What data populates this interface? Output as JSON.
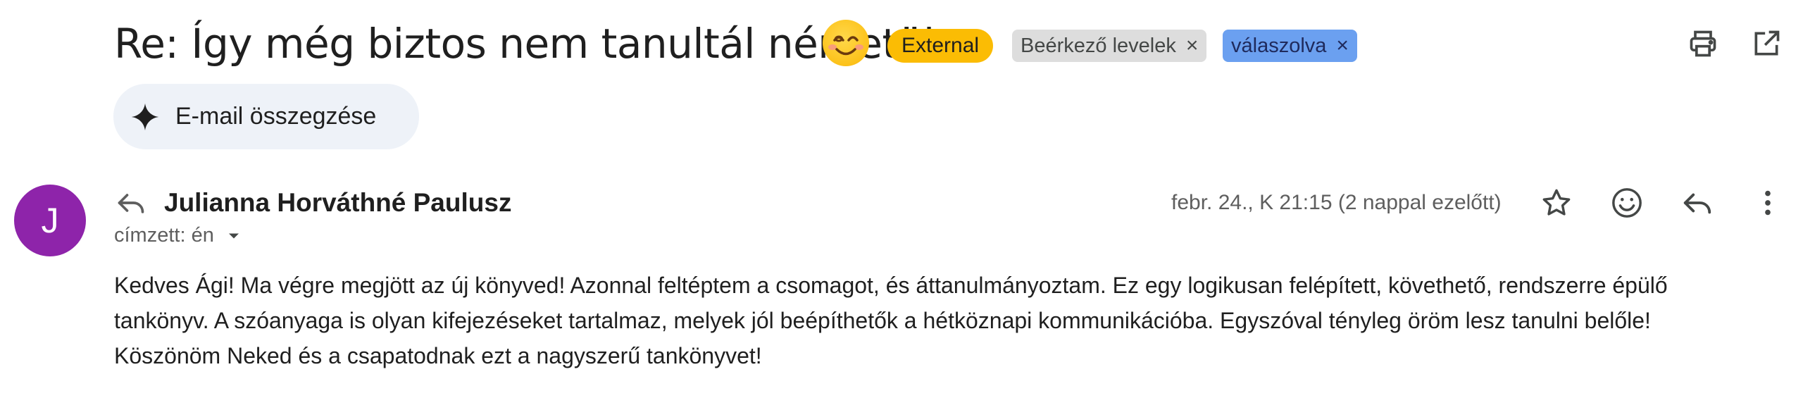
{
  "subject": {
    "title": "Re: Így még biztos nem tanultál németül",
    "emoji": "smiling-face-emoji"
  },
  "labels": [
    {
      "text": "External",
      "color": "#fbbc04"
    },
    {
      "text": "Beérkező levelek",
      "color": "#dddddd",
      "remove": "×"
    },
    {
      "text": "válaszolva",
      "color": "#6ba0f0",
      "remove": "×"
    }
  ],
  "toolbar": {
    "print_icon": "print-icon",
    "popout_icon": "open-in-new-window-icon"
  },
  "summarize": {
    "label": "E-mail összegzése",
    "icon": "sparkle-icon"
  },
  "message": {
    "avatar_letter": "J",
    "avatar_color": "#8e24aa",
    "sender": "Julianna Horváthné Paulusz",
    "recipient": "címzett: én",
    "date": "febr. 24., K 21:15 (2 nappal ezelőtt)",
    "body_lines": [
      "Kedves Ági! Ma végre megjött az új könyved! Azonnal feltéptem a csomagot, és áttanulmányoztam. Ez egy logikusan felépített, követhető, rendszerre épülő",
      "tankönyv. A szóanyaga is olyan kifejezéseket tartalmaz, melyek jól beépíthetők a hétköznapi kommunikációba. Egyszóval tényleg öröm lesz tanulni belőle!",
      "Köszönöm Neked és a csapatodnak ezt a nagyszerű tankönyvet!"
    ]
  }
}
